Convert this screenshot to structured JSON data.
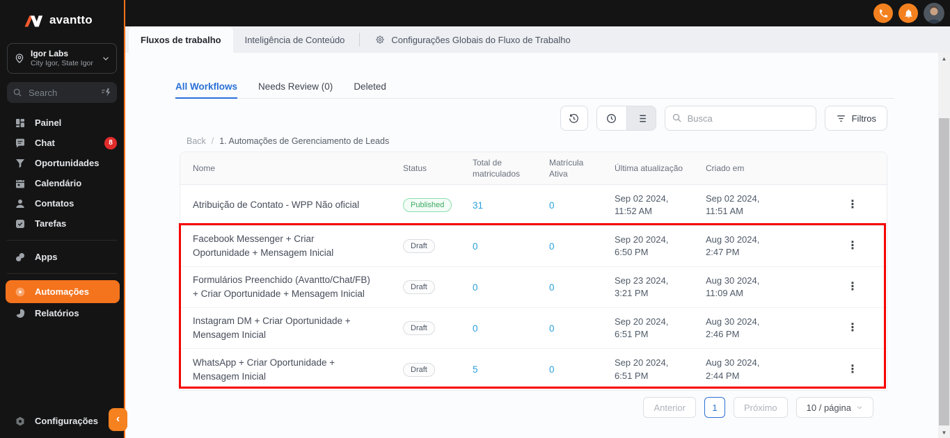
{
  "brand": {
    "name": "avantto"
  },
  "sidebar": {
    "account": {
      "name": "Igor Labs",
      "location": "City Igor, State Igor"
    },
    "search": {
      "placeholder": "Search"
    },
    "menu": [
      {
        "label": "Painel"
      },
      {
        "label": "Chat",
        "badge": "8"
      },
      {
        "label": "Oportunidades"
      },
      {
        "label": "Calendário"
      },
      {
        "label": "Contatos"
      },
      {
        "label": "Tarefas"
      }
    ],
    "apps": {
      "label": "Apps"
    },
    "automations": {
      "label": "Automações"
    },
    "reports": {
      "label": "Relatórios"
    },
    "settings": {
      "label": "Configurações"
    }
  },
  "tabs": {
    "workflow": "Fluxos de trabalho",
    "content_ai": "Inteligência de Conteúdo",
    "global_settings": "Configurações Globais do Fluxo de Trabalho"
  },
  "subtabs": [
    {
      "label": "All Workflows"
    },
    {
      "label": "Needs Review (0)"
    },
    {
      "label": "Deleted"
    }
  ],
  "toolbar": {
    "search_placeholder": "Busca",
    "filters_label": "Filtros"
  },
  "breadcrumb": {
    "back": "Back",
    "separator": "/",
    "current": "1. Automações de Gerenciamento de Leads"
  },
  "table": {
    "columns": [
      "Nome",
      "Status",
      "Total de matriculados",
      "Matrícula Ativa",
      "Última atualização",
      "Criado em"
    ],
    "rows": [
      {
        "name": "Atribuição de Contato - WPP Não oficial",
        "status": "Published",
        "total": "31",
        "active": "0",
        "updated_date": "Sep 02 2024,",
        "updated_time": "11:52 AM",
        "created_date": "Sep 02 2024,",
        "created_time": "11:51 AM"
      },
      {
        "name": "Facebook Messenger + Criar Oportunidade + Mensagem Inicial",
        "status": "Draft",
        "total": "0",
        "active": "0",
        "updated_date": "Sep 20 2024,",
        "updated_time": "6:50 PM",
        "created_date": "Aug 30 2024,",
        "created_time": "2:47 PM"
      },
      {
        "name": "Formulários Preenchido (Avantto/Chat/FB) + Criar Oportunidade + Mensagem Inicial",
        "status": "Draft",
        "total": "0",
        "active": "0",
        "updated_date": "Sep 23 2024,",
        "updated_time": "3:21 PM",
        "created_date": "Aug 30 2024,",
        "created_time": "11:09 AM"
      },
      {
        "name": "Instagram DM + Criar Oportunidade + Mensagem Inicial",
        "status": "Draft",
        "total": "0",
        "active": "0",
        "updated_date": "Sep 20 2024,",
        "updated_time": "6:51 PM",
        "created_date": "Aug 30 2024,",
        "created_time": "2:46 PM"
      },
      {
        "name": "WhatsApp + Criar Oportunidade + Mensagem Inicial",
        "status": "Draft",
        "total": "5",
        "active": "0",
        "updated_date": "Sep 20 2024,",
        "updated_time": "6:51 PM",
        "created_date": "Aug 30 2024,",
        "created_time": "2:44 PM"
      }
    ]
  },
  "pagination": {
    "prev": "Anterior",
    "page": "1",
    "next": "Próximo",
    "page_size": "10 / página"
  },
  "colors": {
    "accent_orange": "#F4731D",
    "link_blue": "#2970D6",
    "number_blue": "#2AA0DC",
    "published_green": "#3CAA63",
    "badge_red": "#E12B2B",
    "annotation_red": "#F70000",
    "sidebar_bg": "#141414"
  }
}
